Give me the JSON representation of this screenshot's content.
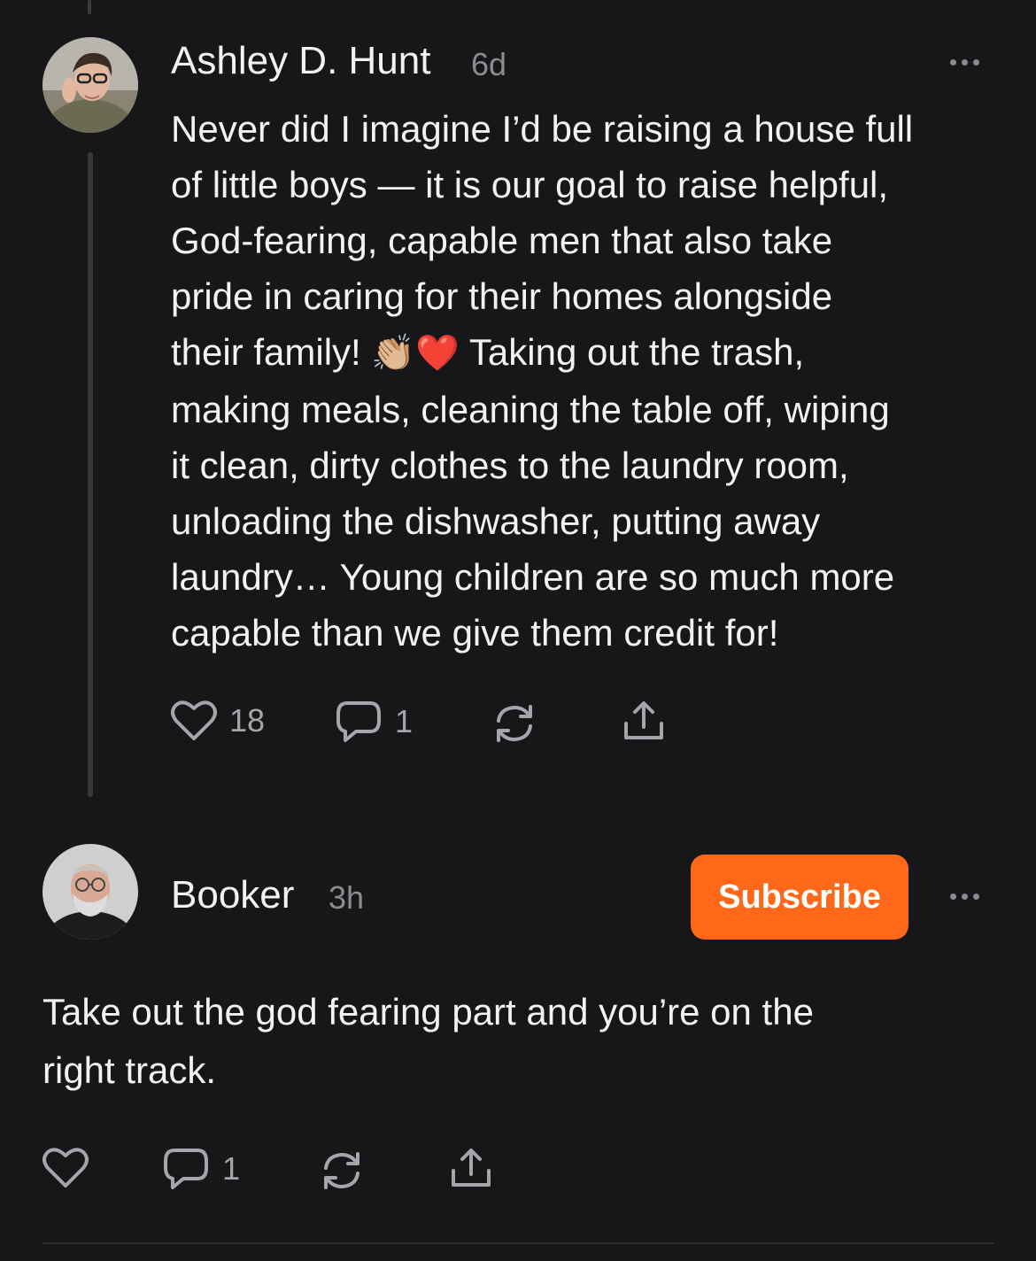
{
  "comment_1": {
    "author": "Ashley D. Hunt",
    "time": "6d",
    "text_lines": [
      "Never did I imagine I’d be raising a house full",
      "of little boys — it is our goal to raise helpful,",
      "God-fearing, capable men that also take",
      "pride in caring for their homes alongside"
    ],
    "text_line5_start": "their family!",
    "text_line5_emoji": "👏🏼❤️",
    "text_line5_end": "Taking out the trash,",
    "text_lines_rest": [
      "making meals, cleaning the table off, wiping",
      "it clean, dirty clothes to the laundry room,",
      "unloading the dishwasher, putting away",
      "laundry… Young children are so much more",
      "capable than we give them credit for!"
    ],
    "likes": "18",
    "replies": "1"
  },
  "comment_2": {
    "author": "Booker",
    "time": "3h",
    "subscribe_label": "Subscribe",
    "text_lines": [
      "Take out the god fearing part and you’re on the",
      "right track."
    ],
    "replies": "1"
  },
  "colors": {
    "background": "#17171a",
    "accent": "#ff6719",
    "muted": "#8c8c90"
  },
  "icons": [
    "heart-icon",
    "comment-icon",
    "restack-icon",
    "share-icon",
    "more-icon"
  ]
}
